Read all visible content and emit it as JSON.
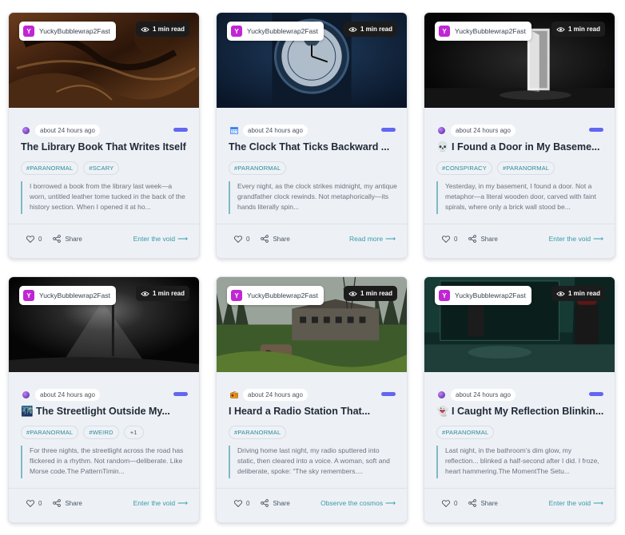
{
  "cards": [
    {
      "author": "YuckyBubblewrap2Fast",
      "author_initial": "Y",
      "read_time": "1 min read",
      "meta_icon": "purple-orb-icon",
      "time": "about 24 hours ago",
      "title": "The Library Book That Writes Itself",
      "tags": [
        "#PARANORMAL",
        "#SCARY"
      ],
      "excerpt": "I borrowed a book from the library last week—a worn, untitled leather tome tucked in the back of the history section. When I opened it at ho...",
      "likes": "0",
      "share_label": "Share",
      "cta": "Enter the void"
    },
    {
      "author": "YuckyBubblewrap2Fast",
      "author_initial": "Y",
      "read_time": "1 min read",
      "meta_icon": "calendar-icon",
      "time": "about 24 hours ago",
      "title": "The Clock That Ticks Backward ...",
      "tags": [
        "#PARANORMAL"
      ],
      "excerpt": "Every night, as the clock strikes midnight, my antique grandfather clock rewinds. Not metaphorically—its hands literally spin...",
      "likes": "0",
      "share_label": "Share",
      "cta": "Read more"
    },
    {
      "author": "YuckyBubblewrap2Fast",
      "author_initial": "Y",
      "read_time": "1 min read",
      "meta_icon": "purple-orb-icon",
      "time": "about 24 hours ago",
      "title": "💀 I Found a Door in My Baseme...",
      "tags": [
        "#CONSPIRACY",
        "#PARANORMAL"
      ],
      "excerpt": "Yesterday, in my basement, I found a door. Not a metaphor—a literal wooden door, carved with faint spirals, where only a brick wall stood be...",
      "likes": "0",
      "share_label": "Share",
      "cta": "Enter the void"
    },
    {
      "author": "YuckyBubblewrap2Fast",
      "author_initial": "Y",
      "read_time": "1 min read",
      "meta_icon": "purple-orb-icon",
      "time": "about 24 hours ago",
      "title": "🌃 The Streetlight Outside My...",
      "tags": [
        "#PARANORMAL",
        "#WEIRD",
        "+1"
      ],
      "excerpt": "For three nights, the streetlight across the road has flickered in a rhythm. Not random—deliberate. Like Morse code.The PatternTimin...",
      "likes": "0",
      "share_label": "Share",
      "cta": "Enter the void"
    },
    {
      "author": "YuckyBubblewrap2Fast",
      "author_initial": "Y",
      "read_time": "1 min read",
      "meta_icon": "radio-icon",
      "time": "about 24 hours ago",
      "title": "I Heard a Radio Station That...",
      "tags": [
        "#PARANORMAL"
      ],
      "excerpt": "Driving home last night, my radio sputtered into static, then cleared into a voice. A woman, soft and deliberate, spoke: “The sky remembers....",
      "likes": "0",
      "share_label": "Share",
      "cta": "Observe the cosmos"
    },
    {
      "author": "YuckyBubblewrap2Fast",
      "author_initial": "Y",
      "read_time": "1 min read",
      "meta_icon": "purple-orb-icon",
      "time": "about 24 hours ago",
      "title": "👻 I Caught My Reflection Blinkin...",
      "tags": [
        "#PARANORMAL"
      ],
      "excerpt": "Last night, in the bathroom’s dim glow, my reflection... blinked a half-second after I did. I froze, heart hammering.The MomentThe Setu...",
      "likes": "0",
      "share_label": "Share",
      "cta": "Enter the void"
    }
  ]
}
